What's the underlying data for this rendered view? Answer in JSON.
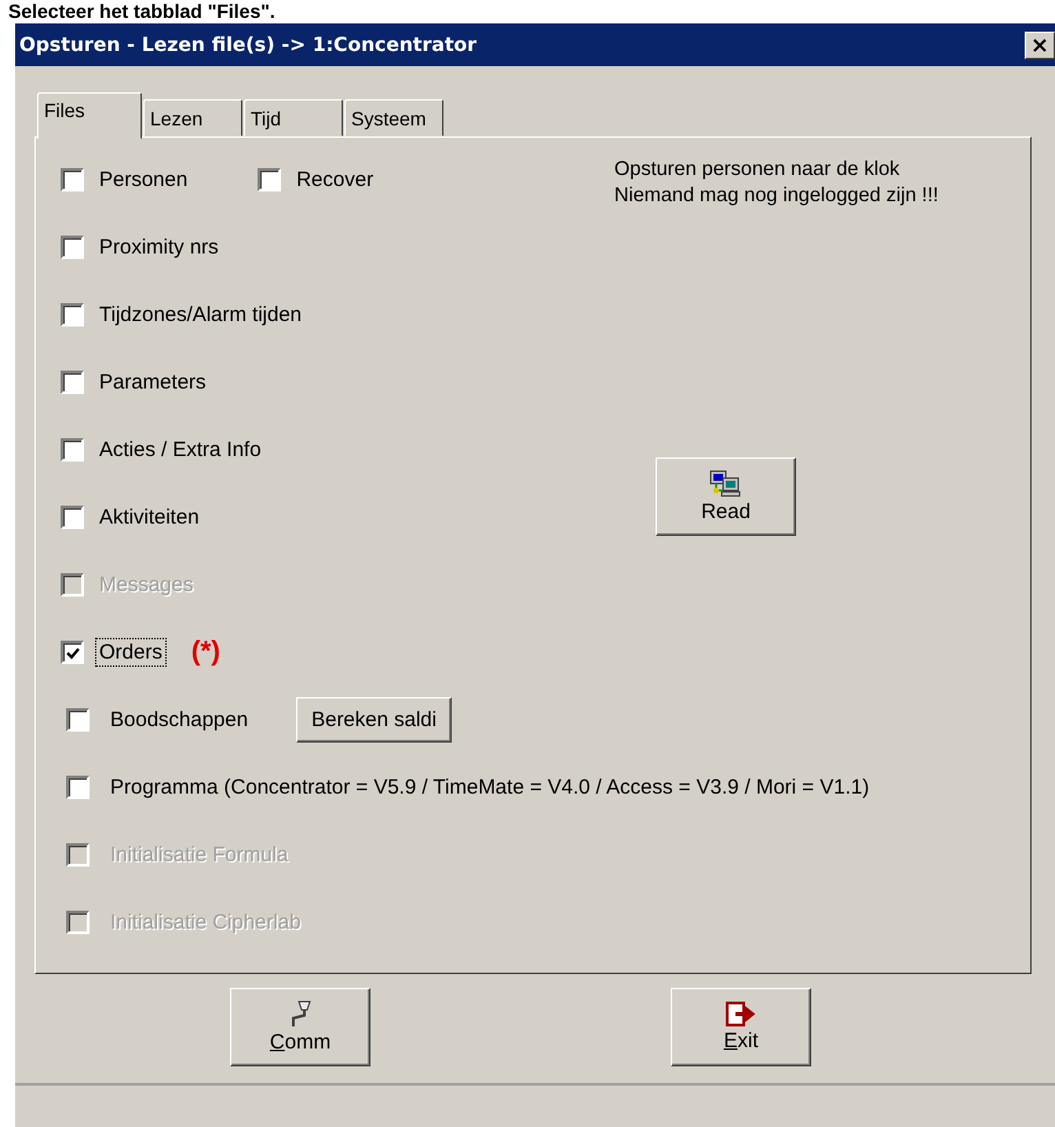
{
  "caption": "Selecteer het tabblad \"Files\".",
  "window": {
    "title": "Opsturen - Lezen  file(s) -> 1:Concentrator",
    "close": "×"
  },
  "tabs": [
    {
      "label": "Files",
      "selected": true
    },
    {
      "label": "Lezen",
      "selected": false
    },
    {
      "label": "Tijd",
      "selected": false
    },
    {
      "label": "Systeem",
      "selected": false
    }
  ],
  "items": [
    {
      "kind": "pair",
      "label": "Personen",
      "checked": false,
      "disabled": false,
      "focused": false,
      "second": {
        "label": "Recover",
        "checked": false
      }
    },
    {
      "kind": "plain",
      "label": "Proximity nrs",
      "checked": false,
      "disabled": false,
      "focused": false
    },
    {
      "kind": "plain",
      "label": "Tijdzones/Alarm tijden",
      "checked": false,
      "disabled": false,
      "focused": false
    },
    {
      "kind": "plain",
      "label": "Parameters",
      "checked": false,
      "disabled": false,
      "focused": false
    },
    {
      "kind": "plain",
      "label": "Acties / Extra Info",
      "checked": false,
      "disabled": false,
      "focused": false
    },
    {
      "kind": "plain",
      "label": "Aktiviteiten",
      "checked": false,
      "disabled": false,
      "focused": false
    },
    {
      "kind": "plain",
      "label": "Messages",
      "checked": false,
      "disabled": true,
      "focused": false
    },
    {
      "kind": "note",
      "label": "Orders",
      "checked": true,
      "disabled": false,
      "focused": true,
      "note": "(*)"
    },
    {
      "kind": "button",
      "label": "Boodschappen",
      "checked": false,
      "disabled": false,
      "focused": false,
      "button": "Bereken saldi"
    },
    {
      "kind": "plain",
      "label": "Programma (Concentrator = V5.9 / TimeMate = V4.0 / Access = V3.9 / Mori = V1.1)",
      "checked": false,
      "disabled": false,
      "focused": false
    },
    {
      "kind": "plain",
      "label": "Initialisatie Formula",
      "checked": false,
      "disabled": true,
      "focused": false
    },
    {
      "kind": "plain",
      "label": "Initialisatie Cipherlab",
      "checked": false,
      "disabled": true,
      "focused": false
    }
  ],
  "info": [
    "Opsturen personen naar de klok",
    "Niemand mag nog ingelogged zijn !!!"
  ],
  "read_button": "Read",
  "footer_buttons": [
    {
      "kind": "comm",
      "label": "Comm"
    },
    {
      "kind": "exit",
      "label": "Exit"
    }
  ]
}
